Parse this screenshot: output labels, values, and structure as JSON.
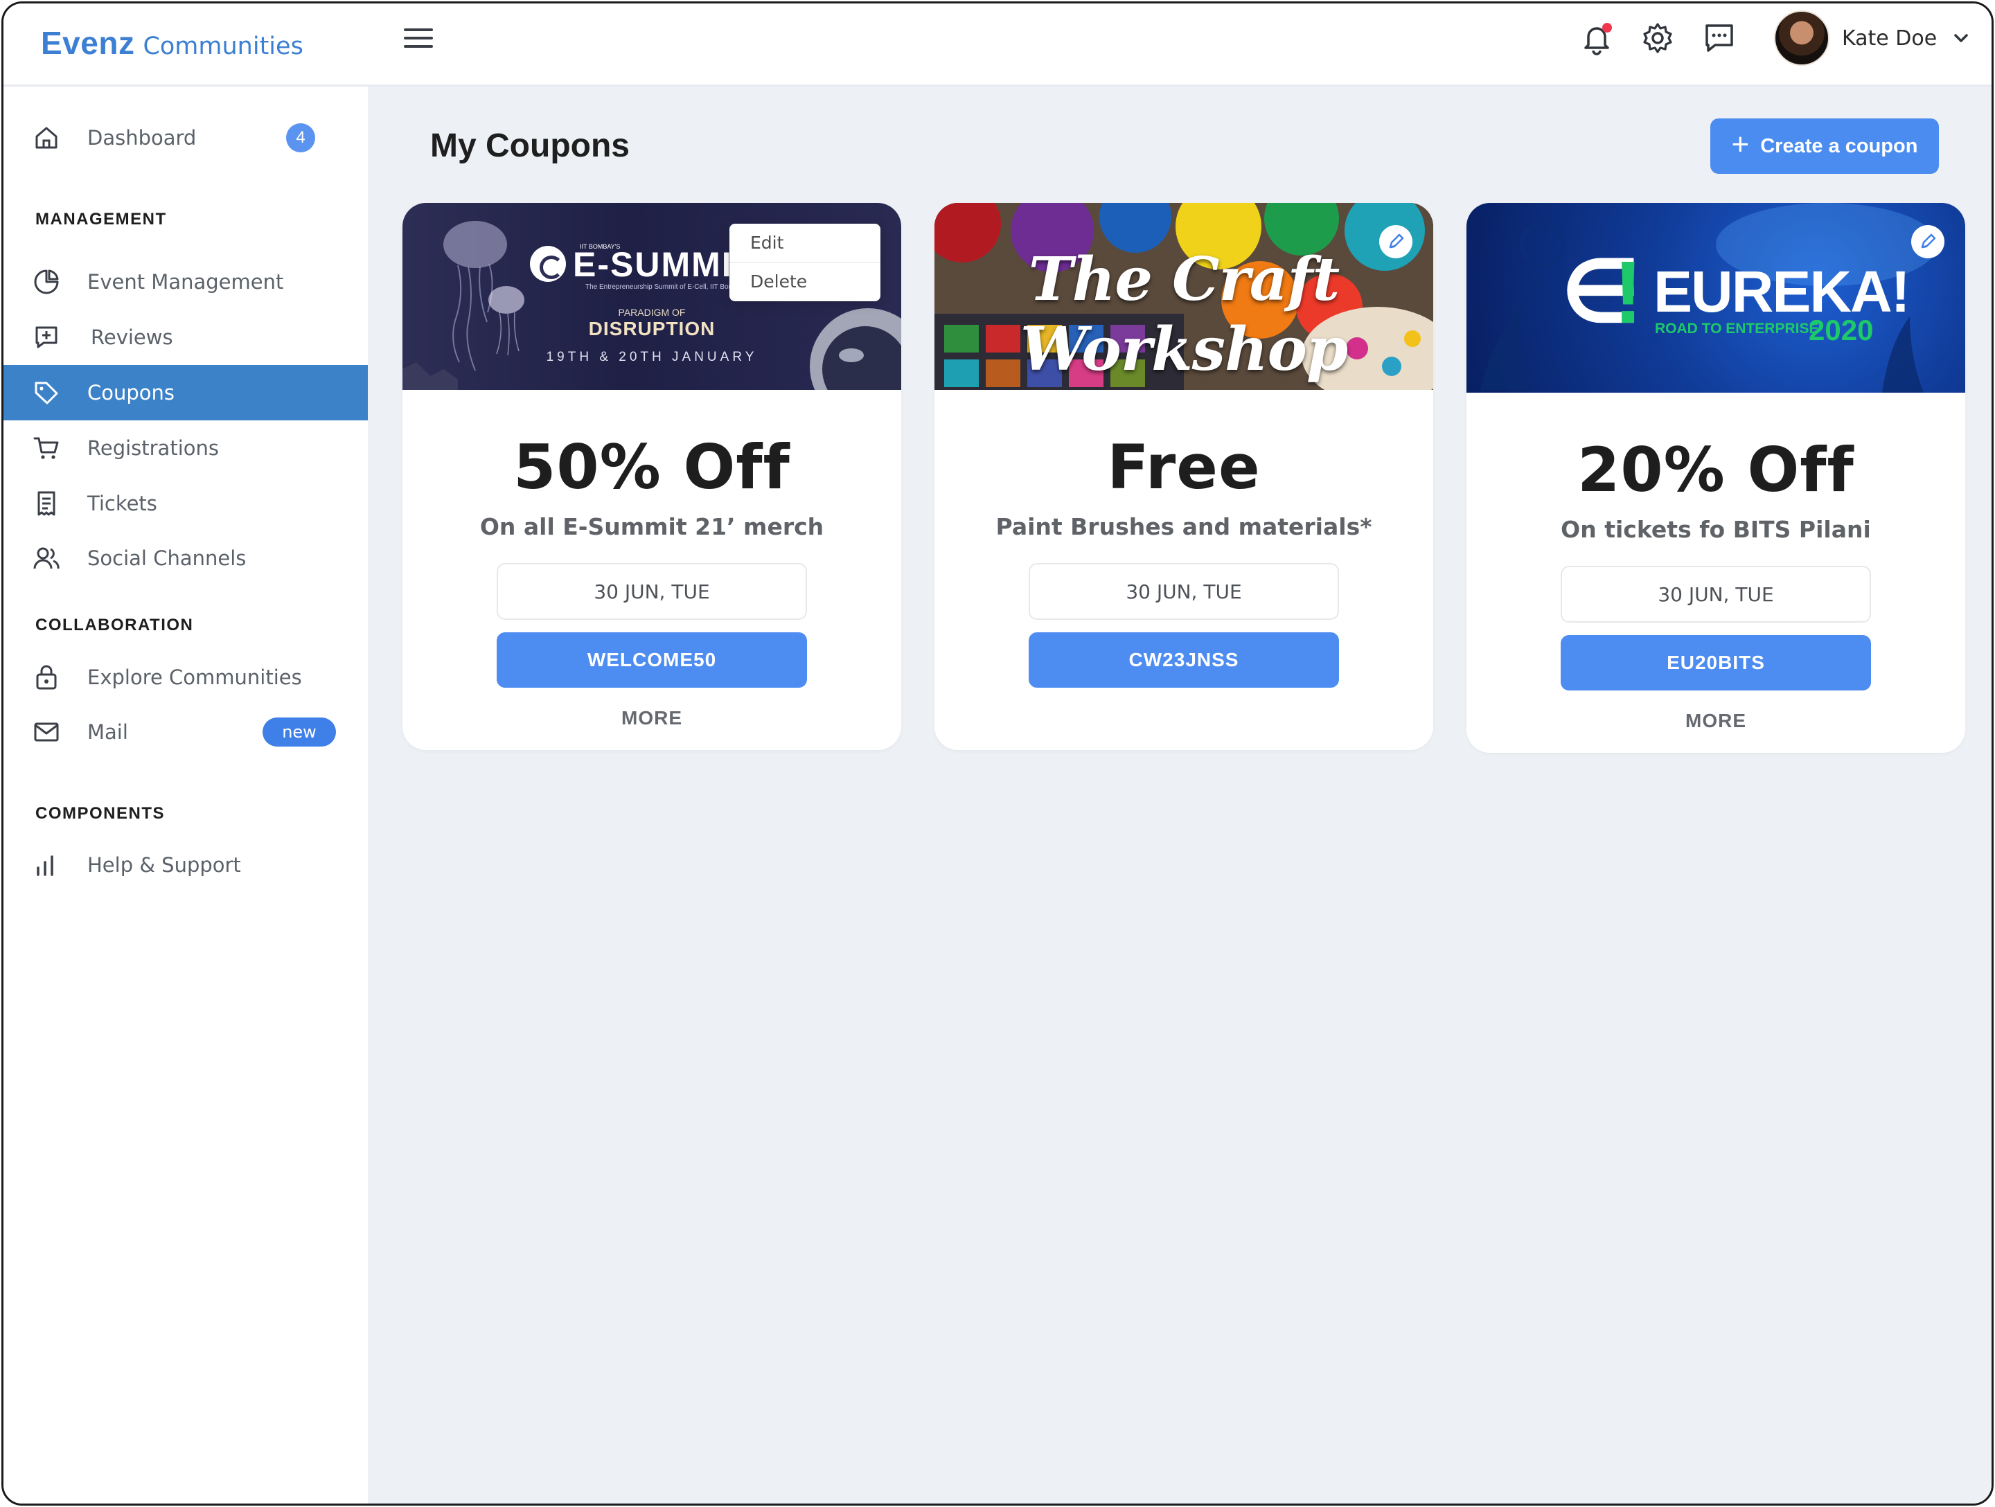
{
  "app": {
    "brand_primary": "Evenz",
    "brand_secondary": "Communities"
  },
  "header": {
    "menu_icon": "hamburger-icon",
    "notifications_icon": "bell-icon",
    "settings_icon": "gear-icon",
    "messages_icon": "chat-icon",
    "user_name": "Kate Doe"
  },
  "sidebar": {
    "dashboard": {
      "label": "Dashboard",
      "badge": "4"
    },
    "sections": {
      "management": "MANAGEMENT",
      "collaboration": "COLLABORATION",
      "components": "COMPONENTS"
    },
    "items": [
      {
        "label": "Event Management",
        "icon": "pie-chart-icon"
      },
      {
        "label": "Reviews",
        "icon": "add-review-icon"
      },
      {
        "label": "Coupons",
        "icon": "tag-icon",
        "active": true
      },
      {
        "label": "Registrations",
        "icon": "cart-icon"
      },
      {
        "label": "Tickets",
        "icon": "ticket-icon"
      },
      {
        "label": "Social Channels",
        "icon": "users-icon"
      },
      {
        "label": "Explore Communities",
        "icon": "lock-icon"
      },
      {
        "label": "Mail",
        "icon": "mail-icon",
        "badge": "new"
      },
      {
        "label": "Help & Support",
        "icon": "bar-chart-icon"
      }
    ]
  },
  "main": {
    "title": "My Coupons",
    "create_button": "Create a coupon",
    "context_menu": [
      "Edit",
      "Delete"
    ],
    "coupons": [
      {
        "headline": "50% Off",
        "subtitle": "On all E-Summit 21’ merch",
        "date": "30 JUN, TUE",
        "code": "WELCOME50",
        "more": "MORE",
        "banner": {
          "title": "E-SUMMIT",
          "kicker": "IIT BOMBAY'S",
          "tagline": "The Entrepreneurship Summit of E-Cell, IIT Bombay",
          "theme_top": "PARADIGM OF",
          "theme": "DISRUPTION",
          "dates": "19TH & 20TH JANUARY"
        }
      },
      {
        "headline": "Free",
        "subtitle": "Paint Brushes and materials*",
        "date": "30 JUN, TUE",
        "code": "CW23JNSS",
        "banner": {
          "title": "The Craft Workshop"
        }
      },
      {
        "headline": "20% Off",
        "subtitle": "On tickets fo BITS Pilani",
        "date": "30 JUN, TUE",
        "code": "EU20BITS",
        "more": "MORE",
        "banner": {
          "title": "EUREKA!",
          "subtitle": "ROAD TO ENTERPRISE",
          "year": "2020"
        }
      }
    ]
  },
  "colors": {
    "brand": "#3c7fd3",
    "active_nav": "#3b82c9",
    "primary_button": "#4d8cf1",
    "main_background": "#edf1f5",
    "notification_dot": "#f0384d",
    "eureka_green": "#1ec96a"
  }
}
